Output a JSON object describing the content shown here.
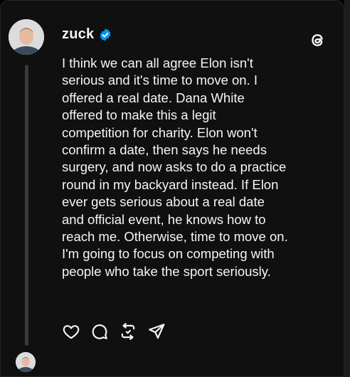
{
  "post": {
    "username": "zuck",
    "verified": true,
    "text": "I think we can all agree Elon isn't\nserious and it's time to move on. I\noffered a real date. Dana White\noffered to make this a legit\ncompetition for charity. Elon won't\nconfirm a date, then says he needs\nsurgery, and now asks to do a practice\nround in my backyard instead. If Elon\never gets serious about a real date\nand official event, he knows how to\nreach me. Otherwise, time to move on.\nI'm going to focus on competing with\npeople who take the sport seriously."
  },
  "icons": {
    "avatar": "profile-photo",
    "verified": "verified-badge-icon",
    "brand": "threads-logo-icon",
    "actions": [
      "heart-icon",
      "comment-icon",
      "repost-icon",
      "share-icon"
    ]
  },
  "colors": {
    "background": "#101010",
    "text": "#f3f5f7",
    "verified": "#0095f6",
    "thread_line": "#3a3a3a"
  }
}
